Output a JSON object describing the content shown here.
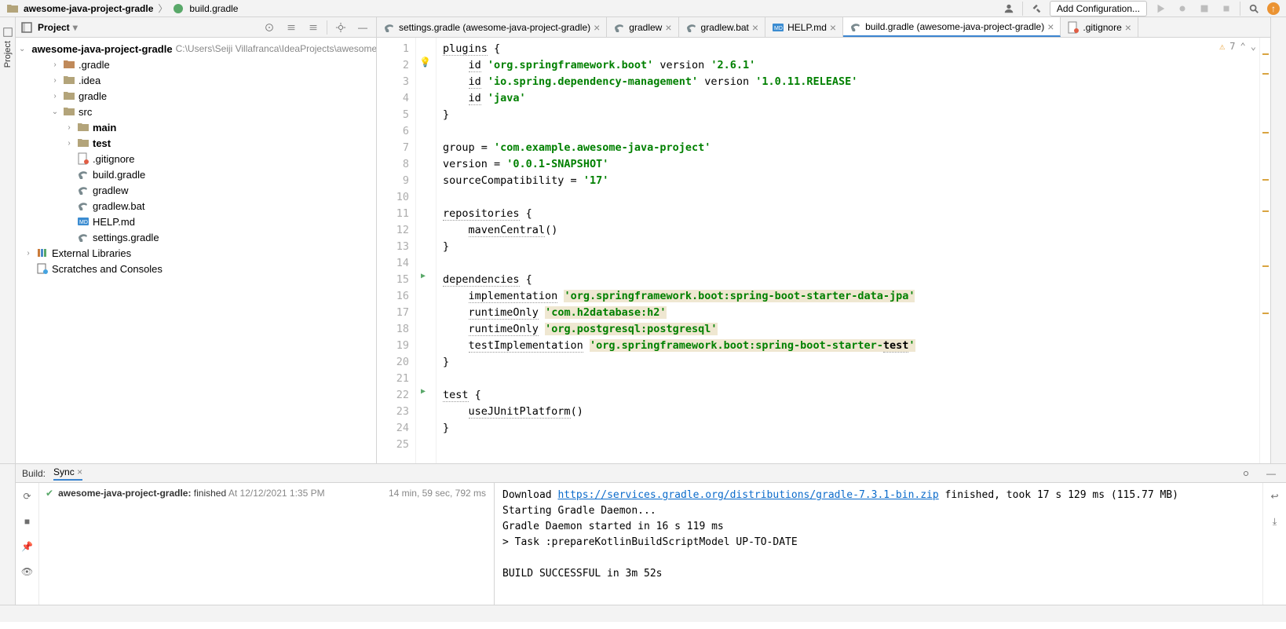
{
  "breadcrumb": {
    "parts": [
      "awesome-java-project-gradle",
      "build.gradle"
    ]
  },
  "toolbar": {
    "config_button": "Add Configuration..."
  },
  "sidebar": {
    "project_label": "Project"
  },
  "tree": {
    "root": {
      "name": "awesome-java-project-gradle",
      "path": "C:\\Users\\Seiji Villafranca\\IdeaProjects\\awesome-ja"
    },
    "items": [
      {
        "name": ".gradle",
        "type": "folder-brown",
        "depth": 1,
        "arrow": ">"
      },
      {
        "name": ".idea",
        "type": "folder",
        "depth": 1,
        "arrow": ">"
      },
      {
        "name": "gradle",
        "type": "folder",
        "depth": 1,
        "arrow": ">"
      },
      {
        "name": "src",
        "type": "folder",
        "depth": 1,
        "arrow": "v"
      },
      {
        "name": "main",
        "type": "folder",
        "depth": 2,
        "arrow": ">",
        "bold": true
      },
      {
        "name": "test",
        "type": "folder",
        "depth": 2,
        "arrow": ">",
        "bold": true
      },
      {
        "name": ".gitignore",
        "type": "gitignore",
        "depth": 2
      },
      {
        "name": "build.gradle",
        "type": "gradle",
        "depth": 2
      },
      {
        "name": "gradlew",
        "type": "gradle",
        "depth": 2
      },
      {
        "name": "gradlew.bat",
        "type": "gradle",
        "depth": 2
      },
      {
        "name": "HELP.md",
        "type": "md",
        "depth": 2
      },
      {
        "name": "settings.gradle",
        "type": "gradle",
        "depth": 2
      }
    ],
    "external": "External Libraries",
    "scratches": "Scratches and Consoles"
  },
  "tabs": [
    {
      "label": "settings.gradle (awesome-java-project-gradle)",
      "active": false,
      "icon": "gradle"
    },
    {
      "label": "gradlew",
      "active": false,
      "icon": "gradle"
    },
    {
      "label": "gradlew.bat",
      "active": false,
      "icon": "gradle"
    },
    {
      "label": "HELP.md",
      "active": false,
      "icon": "md"
    },
    {
      "label": "build.gradle (awesome-java-project-gradle)",
      "active": true,
      "icon": "gradle"
    },
    {
      "label": ".gitignore",
      "active": false,
      "icon": "gitignore"
    }
  ],
  "editor": {
    "warnings": "7",
    "lines": [
      "plugins {",
      "    id 'org.springframework.boot' version '2.6.1'",
      "    id 'io.spring.dependency-management' version '1.0.11.RELEASE'",
      "    id 'java'",
      "}",
      "",
      "group = 'com.example.awesome-java-project'",
      "version = '0.0.1-SNAPSHOT'",
      "sourceCompatibility = '17'",
      "",
      "repositories {",
      "    mavenCentral()",
      "}",
      "",
      "dependencies {",
      "    implementation 'org.springframework.boot:spring-boot-starter-data-jpa'",
      "    runtimeOnly 'com.h2database:h2'",
      "    runtimeOnly 'org.postgresql:postgresql'",
      "    testImplementation 'org.springframework.boot:spring-boot-starter-test'",
      "}",
      "",
      "test {",
      "    useJUnitPlatform()",
      "}",
      ""
    ]
  },
  "build": {
    "tab_build": "Build:",
    "tab_sync": "Sync",
    "status_bold": "awesome-java-project-gradle:",
    "status_text": "finished",
    "status_at": "At 12/12/2021 1:35 PM",
    "duration": "14 min, 59 sec, 792 ms",
    "output_download_pre": "Download ",
    "output_url": "https://services.gradle.org/distributions/gradle-7.3.1-bin.zip",
    "output_download_post": " finished, took 17 s 129 ms (115.77 MB)",
    "output_l2": "Starting Gradle Daemon...",
    "output_l3": "Gradle Daemon started in 16 s 119 ms",
    "output_l4": "> Task :prepareKotlinBuildScriptModel UP-TO-DATE",
    "output_l5": "",
    "output_l6": "BUILD SUCCESSFUL in 3m 52s"
  }
}
